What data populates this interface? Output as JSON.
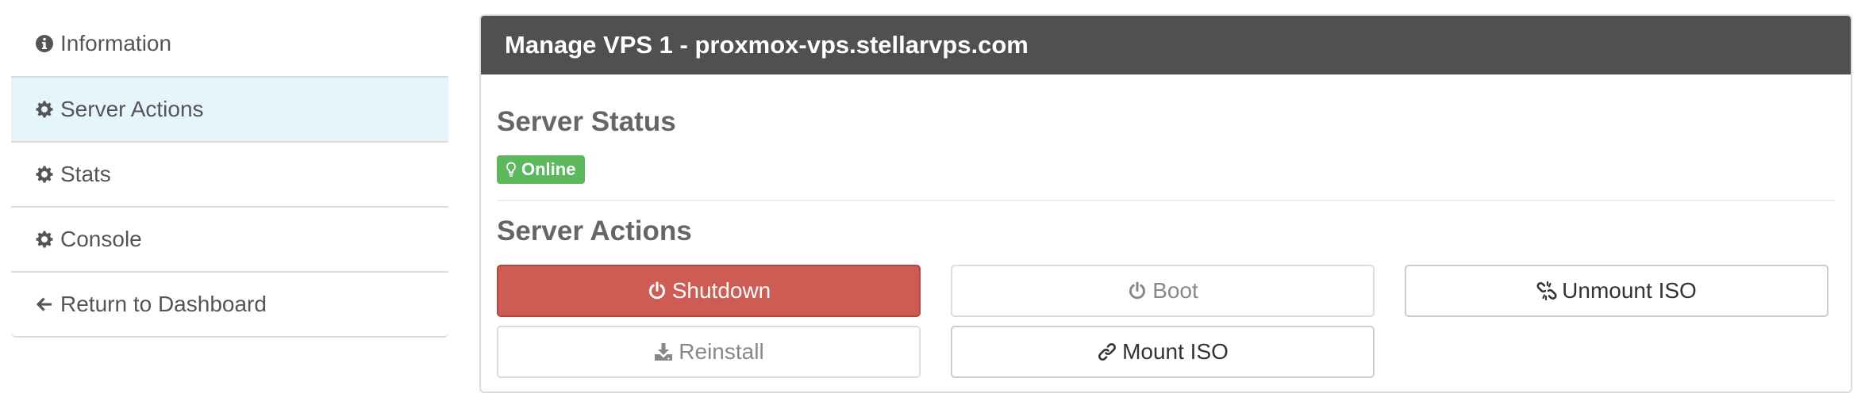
{
  "sidebar": {
    "items": [
      {
        "label": "Information",
        "icon": "info-circle-icon",
        "active": false
      },
      {
        "label": "Server Actions",
        "icon": "gear-icon",
        "active": true
      },
      {
        "label": "Stats",
        "icon": "gear-icon",
        "active": false
      },
      {
        "label": "Console",
        "icon": "gear-icon",
        "active": false
      },
      {
        "label": "Return to Dashboard",
        "icon": "arrow-left-icon",
        "active": false
      }
    ]
  },
  "panel": {
    "title": "Manage VPS 1 - proxmox-vps.stellarvps.com",
    "status_section_title": "Server Status",
    "status_badge": {
      "label": "Online",
      "icon": "lightbulb-icon",
      "color": "#5cb85c"
    },
    "actions_section_title": "Server Actions",
    "buttons": {
      "shutdown": {
        "label": "Shutdown",
        "icon": "power-icon",
        "color": "#cd5c54"
      },
      "boot": {
        "label": "Boot",
        "icon": "power-icon"
      },
      "unmount_iso": {
        "label": "Unmount ISO",
        "icon": "unlink-icon"
      },
      "reinstall": {
        "label": "Reinstall",
        "icon": "download-icon"
      },
      "mount_iso": {
        "label": "Mount ISO",
        "icon": "link-icon"
      }
    }
  },
  "colors": {
    "panel_heading_bg": "#505050",
    "active_sidebar_bg": "#e6f5fc"
  }
}
